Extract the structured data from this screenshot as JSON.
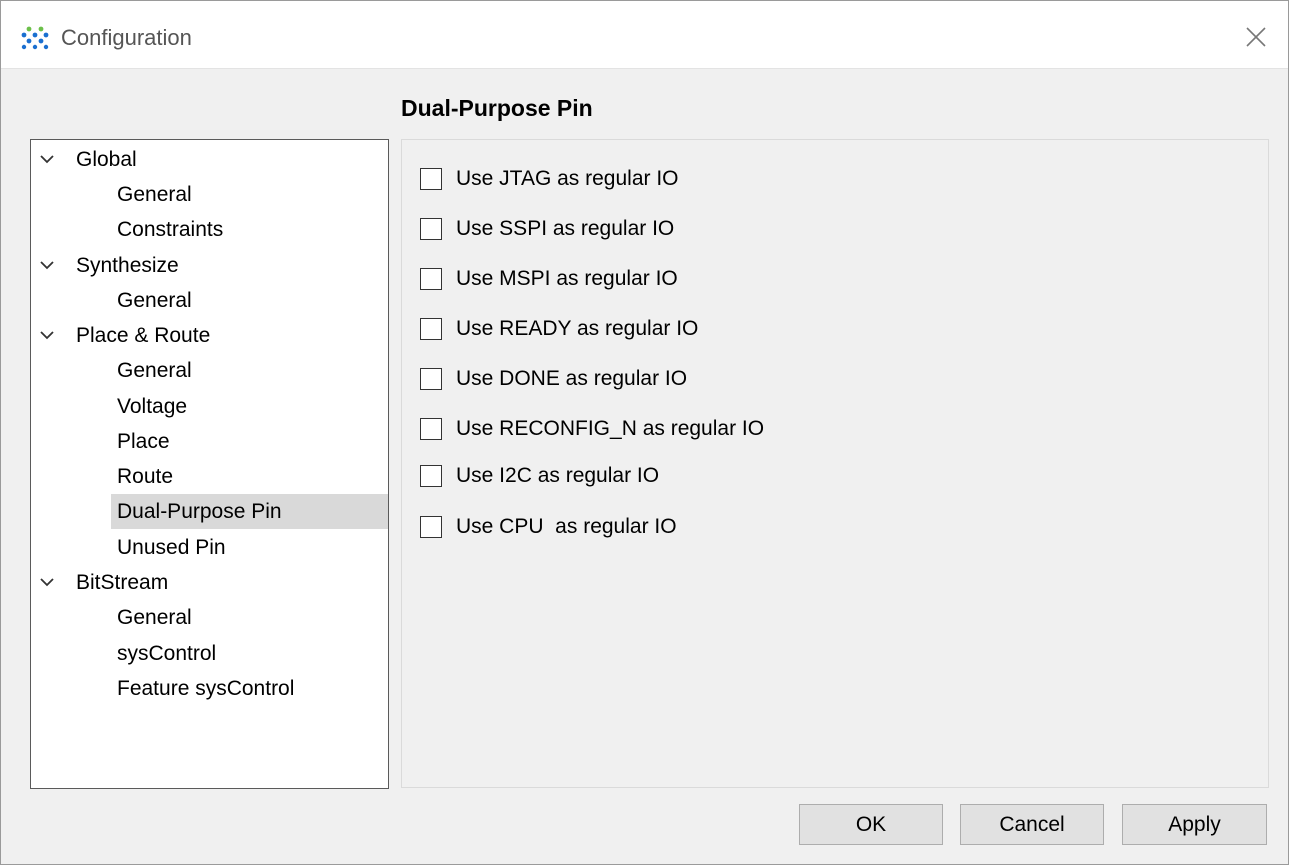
{
  "window": {
    "title": "Configuration",
    "close_icon": "close-icon",
    "logo_icon": "gowin-logo-icon"
  },
  "page": {
    "title": "Dual-Purpose Pin"
  },
  "tree": {
    "groups": [
      {
        "label": "Global",
        "expanded": true,
        "children": [
          "General",
          "Constraints"
        ]
      },
      {
        "label": "Synthesize",
        "expanded": true,
        "children": [
          "General"
        ]
      },
      {
        "label": "Place & Route",
        "expanded": true,
        "children": [
          "General",
          "Voltage",
          "Place",
          "Route",
          "Dual-Purpose Pin",
          "Unused Pin"
        ]
      },
      {
        "label": "BitStream",
        "expanded": true,
        "children": [
          "General",
          "sysControl",
          "Feature sysControl"
        ]
      }
    ],
    "selected": "Dual-Purpose Pin"
  },
  "options": [
    {
      "label": "Use JTAG as regular IO",
      "checked": false
    },
    {
      "label": "Use SSPI as regular IO",
      "checked": false
    },
    {
      "label": "Use MSPI as regular IO",
      "checked": false
    },
    {
      "label": "Use READY as regular IO",
      "checked": false
    },
    {
      "label": "Use DONE as regular IO",
      "checked": false
    },
    {
      "label": "Use RECONFIG_N as regular IO",
      "checked": false
    },
    {
      "label": "Use I2C as regular IO",
      "checked": false
    },
    {
      "label": "Use CPU  as regular IO",
      "checked": false
    }
  ],
  "buttons": {
    "ok": "OK",
    "cancel": "Cancel",
    "apply": "Apply"
  },
  "colors": {
    "dialog_bg": "#f0f0f0",
    "selection_bg": "#d9d9d9",
    "logo_blue": "#1a6fd0",
    "logo_green": "#6cc04a"
  }
}
